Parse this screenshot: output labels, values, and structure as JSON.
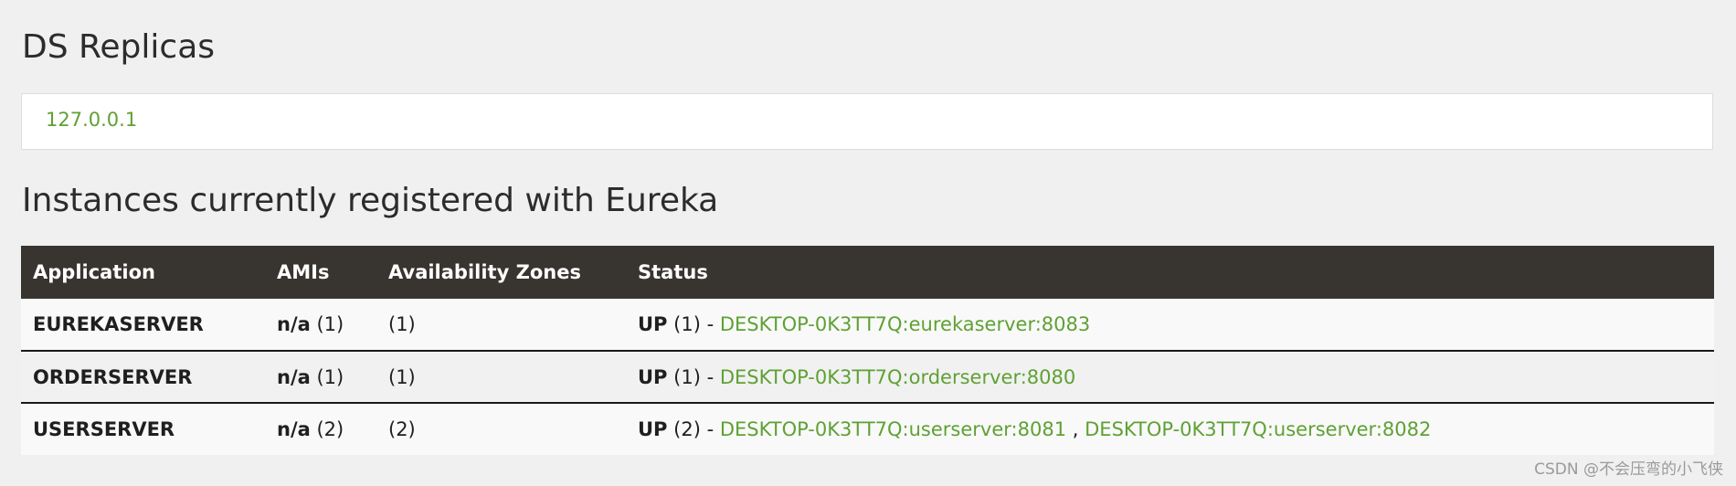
{
  "ds_replicas": {
    "title": "DS Replicas",
    "replicas": [
      "127.0.0.1"
    ]
  },
  "instances": {
    "title": "Instances currently registered with Eureka",
    "headers": {
      "application": "Application",
      "amis": "AMIs",
      "zones": "Availability Zones",
      "status": "Status"
    },
    "rows": [
      {
        "application": "EUREKASERVER",
        "ami_label": "n/a",
        "ami_count": "(1)",
        "zones": "(1)",
        "status": "UP",
        "status_count": "(1) -",
        "links": [
          "DESKTOP-0K3TT7Q:eurekaserver:8083"
        ]
      },
      {
        "application": "ORDERSERVER",
        "ami_label": "n/a",
        "ami_count": "(1)",
        "zones": "(1)",
        "status": "UP",
        "status_count": "(1) -",
        "links": [
          "DESKTOP-0K3TT7Q:orderserver:8080"
        ]
      },
      {
        "application": "USERSERVER",
        "ami_label": "n/a",
        "ami_count": "(2)",
        "zones": "(2)",
        "status": "UP",
        "status_count": "(2) -",
        "links": [
          "DESKTOP-0K3TT7Q:userserver:8081",
          "DESKTOP-0K3TT7Q:userserver:8082"
        ],
        "link_separator": ","
      }
    ]
  },
  "watermark": "CSDN @不会压弯的小飞侠",
  "colors": {
    "link": "#5fa134",
    "header_bg": "#38342f",
    "page_bg": "#f0f0f0"
  }
}
